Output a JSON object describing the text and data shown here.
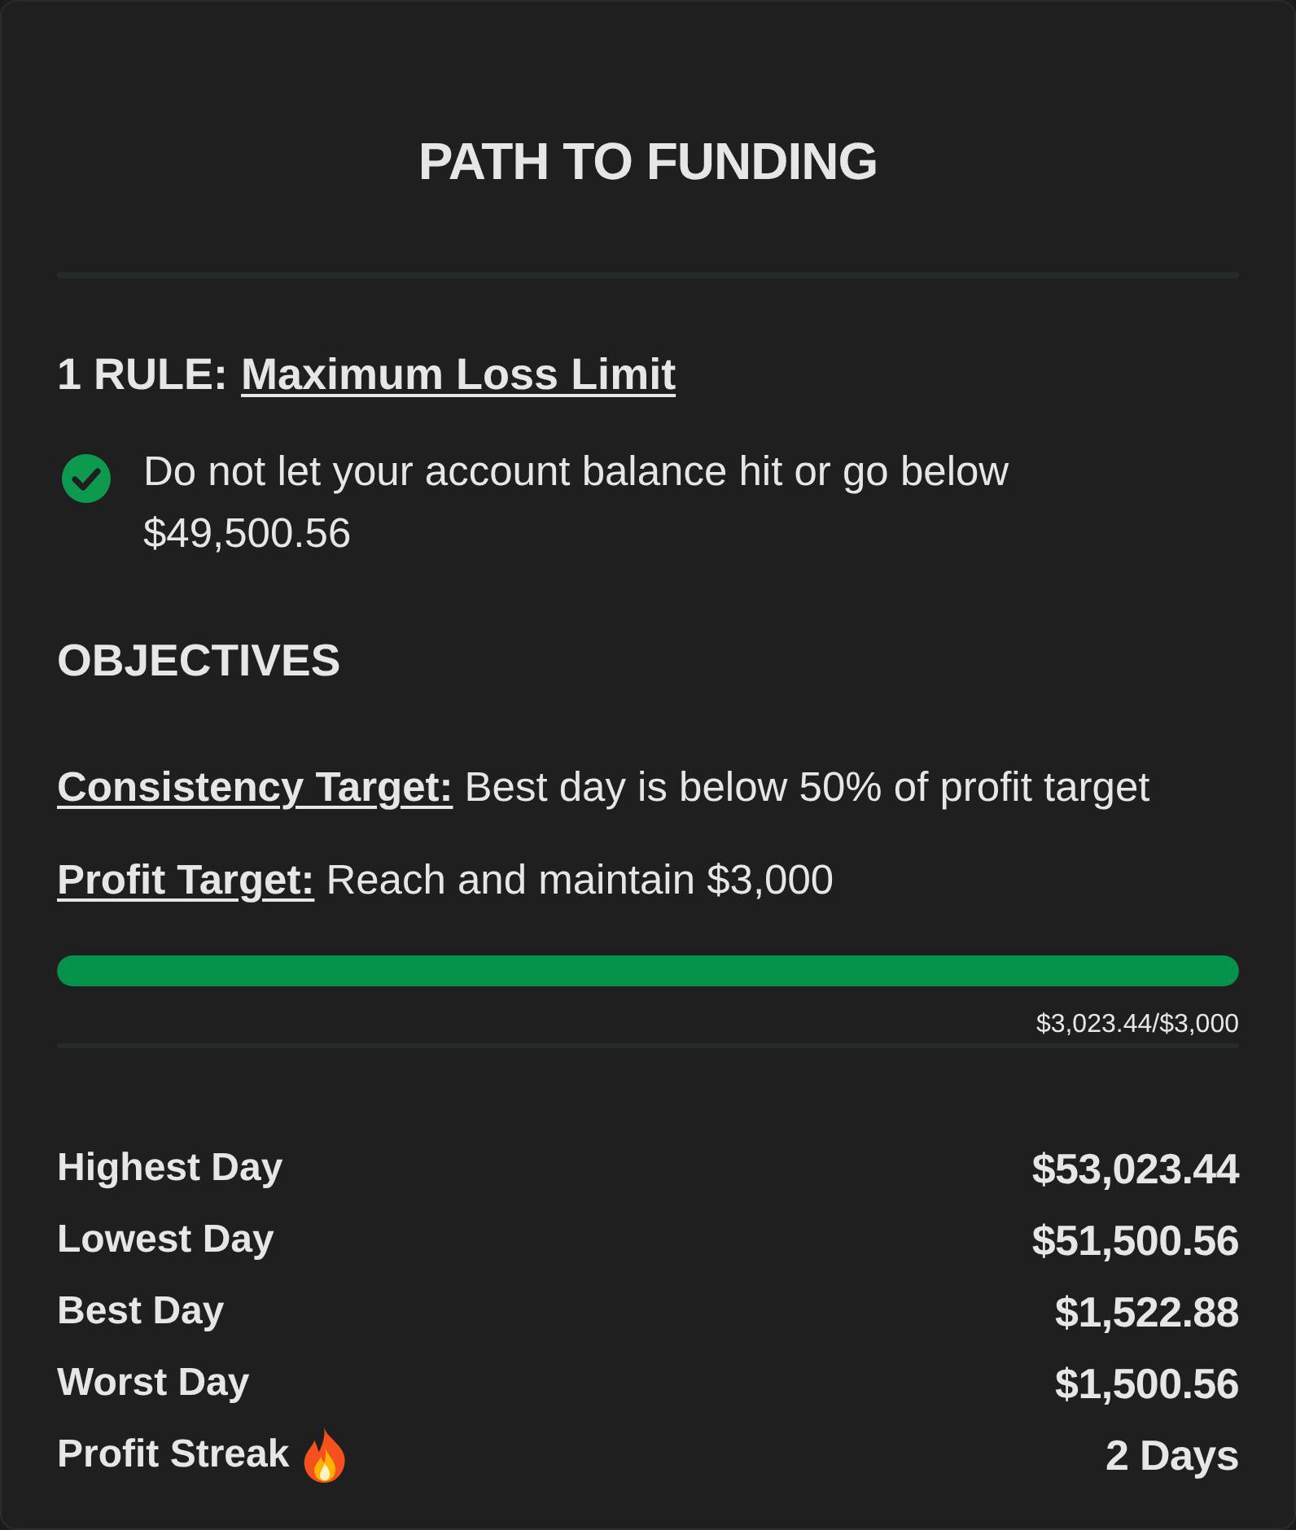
{
  "title": "PATH TO FUNDING",
  "rule": {
    "prefix": "1 RULE:",
    "link": "Maximum Loss Limit",
    "checked": true,
    "text": "Do not let your account balance hit or go below $49,500.56"
  },
  "objectives": {
    "heading": "OBJECTIVES",
    "items": [
      {
        "label": "Consistency Target:",
        "text": "Best day is below 50% of profit target"
      },
      {
        "label": "Profit Target:",
        "text": "Reach and maintain $3,000"
      }
    ]
  },
  "progress": {
    "level": 1,
    "reading": "$3,023.44/$3,000"
  },
  "stats": [
    {
      "kind": "plain",
      "label": "Highest Day",
      "value": "$53,023.44"
    },
    {
      "kind": "plain",
      "label": "Lowest Day",
      "value": "$51,500.56"
    },
    {
      "kind": "plain",
      "label": "Best Day",
      "value": "$1,522.88"
    },
    {
      "kind": "plain",
      "label": "Worst Day",
      "value": "$1,500.56"
    },
    {
      "kind": "streak",
      "label": "Profit Streak",
      "value": "2 Days"
    }
  ]
}
